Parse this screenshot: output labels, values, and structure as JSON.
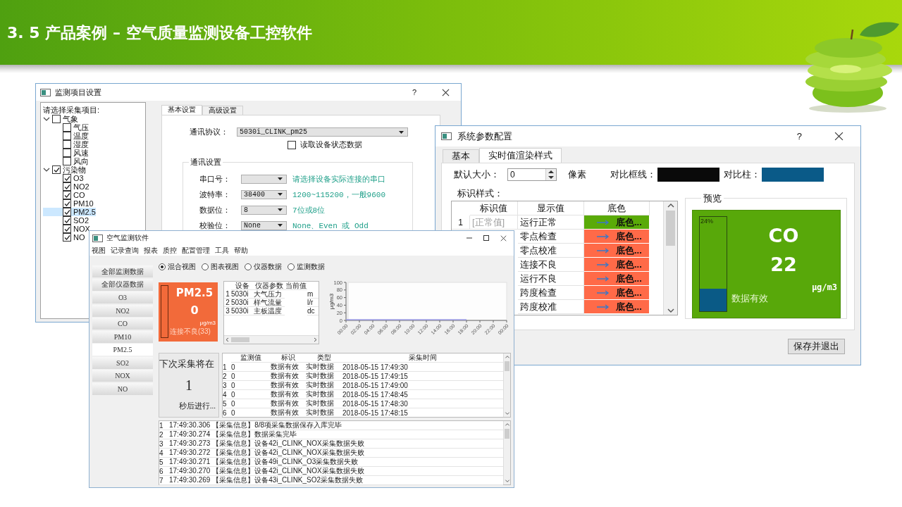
{
  "slide": {
    "title": "3. 5 产品案例 – 空气质量监测设备工控软件"
  },
  "item_settings_window": {
    "title": "监测项目设置",
    "help": "?",
    "tree_label": "请选择采集项目:",
    "tree": [
      {
        "label": "气象",
        "checked": false,
        "expanded": true,
        "selected": false,
        "children": [
          {
            "label": "气压",
            "checked": false,
            "selected": false
          },
          {
            "label": "温度",
            "checked": false,
            "selected": false
          },
          {
            "label": "湿度",
            "checked": false,
            "selected": false
          },
          {
            "label": "风速",
            "checked": false,
            "selected": false
          },
          {
            "label": "风向",
            "checked": false,
            "selected": false
          }
        ]
      },
      {
        "label": "污染物",
        "checked": true,
        "expanded": true,
        "selected": false,
        "children": [
          {
            "label": "O3",
            "checked": true,
            "selected": false
          },
          {
            "label": "NO2",
            "checked": true,
            "selected": false
          },
          {
            "label": "CO",
            "checked": true,
            "selected": false
          },
          {
            "label": "PM10",
            "checked": true,
            "selected": false
          },
          {
            "label": "PM2.5",
            "checked": true,
            "selected": true
          },
          {
            "label": "SO2",
            "checked": true,
            "selected": false
          },
          {
            "label": "NOX",
            "checked": true,
            "selected": false
          },
          {
            "label": "NO",
            "checked": true,
            "selected": false
          }
        ]
      }
    ],
    "tabs": [
      {
        "label": "基本设置",
        "selected": true
      },
      {
        "label": "高级设置",
        "selected": false
      }
    ],
    "protocol": {
      "label": "通讯协议：",
      "value": "5030i_CLINK_pm25"
    },
    "read_status": {
      "label": "读取设备状态数据",
      "checked": false
    },
    "comm_group": {
      "title": "通讯设置",
      "rows": [
        {
          "label": "串口号：",
          "hint": "请选择设备实际连接的串口"
        },
        {
          "label": "波特率：",
          "value": "38400",
          "hint": "1200~115200，一般9600"
        },
        {
          "label": "数据位：",
          "value": "8",
          "hint": "7位或8位"
        },
        {
          "label": "校验位：",
          "value": "None",
          "hint": "None、Even 或 Odd"
        }
      ]
    }
  },
  "config_window": {
    "title": "系统参数配置",
    "help": "?",
    "tabs": [
      {
        "label": "基本",
        "selected": false
      },
      {
        "label": "实时值渲染样式",
        "selected": true
      }
    ],
    "default_size": {
      "label": "默认大小：",
      "value": "0",
      "unit": "像素"
    },
    "contrast_swatches": [
      {
        "label": "对比框线：",
        "color": "#0a0a0a"
      },
      {
        "label": "对比柱：",
        "color": "#0a5a88"
      }
    ],
    "style_table": {
      "label": "标识样式：",
      "columns": [
        "标识值",
        "显示值",
        "底色"
      ],
      "rows": [
        {
          "index": "1",
          "mark": "[正常值]",
          "display": "运行正常",
          "color_text": "底色...",
          "color": "#5aaa08"
        },
        {
          "display": "零点检查",
          "color_text": "底色...",
          "color": "#ff6a48"
        },
        {
          "display": "零点校准",
          "color_text": "底色...",
          "color": "#ff6a48"
        },
        {
          "display": "连接不良",
          "color_text": "底色...",
          "color": "#ff6a48"
        },
        {
          "display": "运行不良",
          "color_text": "底色...",
          "color": "#ff6a48"
        },
        {
          "display": "跨度检查",
          "color_text": "底色...",
          "color": "#ff6a48"
        },
        {
          "display": "跨度校准",
          "color_text": "底色...",
          "color": "#ff6a48"
        }
      ]
    },
    "preview": {
      "title": "预览",
      "level": 0.24,
      "reading": "24%",
      "name": "CO",
      "value": "22",
      "unit": "μg/m3",
      "status": "数据有效"
    },
    "save_button": "保存并退出"
  },
  "app_window": {
    "title": "空气监测软件",
    "menu": [
      "视图",
      "记录查询",
      "报表",
      "质控",
      "配置管理",
      "工具",
      "帮助"
    ],
    "side_buttons": [
      {
        "label": "全部监测数据",
        "selected": false
      },
      {
        "label": "全部仪器数据",
        "selected": false
      },
      {
        "label": "O3",
        "selected": false
      },
      {
        "label": "NO2",
        "selected": false
      },
      {
        "label": "CO",
        "selected": false
      },
      {
        "label": "PM10",
        "selected": false
      },
      {
        "label": "PM2.5",
        "selected": true
      },
      {
        "label": "SO2",
        "selected": false
      },
      {
        "label": "NOX",
        "selected": false
      },
      {
        "label": "NO",
        "selected": false
      }
    ],
    "view_modes": [
      {
        "label": "混合视图",
        "selected": true
      },
      {
        "label": "图表视图",
        "selected": false
      },
      {
        "label": "仪器数据",
        "selected": false
      },
      {
        "label": "监测数据",
        "selected": false
      }
    ],
    "tile": {
      "name": "PM2.5",
      "value": "0",
      "unit": "μg/m3",
      "status": "连接不良(33)"
    },
    "instrument_table": {
      "columns": [
        "设备",
        "仪器参数",
        "当前值"
      ],
      "rows": [
        {
          "index": "1",
          "device": "5030i",
          "parameter": "大气压力",
          "column_5": "m"
        },
        {
          "index": "2",
          "device": "5030i",
          "parameter": "样气流量",
          "column_5": "l/r"
        },
        {
          "index": "3",
          "device": "5030i",
          "parameter": "主板温度",
          "column_5": "dc"
        }
      ]
    },
    "chart_data": {
      "type": "line",
      "ylabel": "μg/m3",
      "categories": [
        "00:00",
        "02:00",
        "04:00",
        "06:00",
        "08:00",
        "10:00",
        "12:00",
        "14:00",
        "16:00",
        "18:00",
        "20:00",
        "22:00",
        "00:00"
      ],
      "series": [
        {
          "color": "#9a9ae6",
          "values": [
            0,
            0,
            0,
            0,
            0,
            0,
            0,
            0,
            0,
            0,
            null,
            null,
            null
          ]
        }
      ],
      "ylim": [
        0,
        100
      ],
      "yticks": [
        0,
        20,
        40,
        60,
        80,
        100
      ]
    },
    "countdown": {
      "prefix": "下次采集将在",
      "value": "1",
      "suffix": "秒后进行..."
    },
    "data_table": {
      "columns": [
        "监测值",
        "标识",
        "类型",
        "采集时间"
      ],
      "rows": [
        {
          "index": "1",
          "value": "0",
          "flag": "数据有效",
          "type": "实时数据",
          "time": "2018-05-15 17:49:30"
        },
        {
          "index": "2",
          "value": "0",
          "flag": "数据有效",
          "type": "实时数据",
          "time": "2018-05-15 17:49:15"
        },
        {
          "index": "3",
          "value": "0",
          "flag": "数据有效",
          "type": "实时数据",
          "time": "2018-05-15 17:49:00"
        },
        {
          "index": "4",
          "value": "0",
          "flag": "数据有效",
          "type": "实时数据",
          "time": "2018-05-15 17:48:45"
        },
        {
          "index": "5",
          "value": "0",
          "flag": "数据有效",
          "type": "实时数据",
          "time": "2018-05-15 17:48:30"
        },
        {
          "index": "6",
          "value": "0",
          "flag": "数据有效",
          "type": "实时数据",
          "time": "2018-05-15 17:48:15"
        }
      ]
    },
    "log": [
      {
        "index": "1",
        "text": "17:49:30.306 【采集信息】8/8项采集数据保存入库完毕"
      },
      {
        "index": "2",
        "text": "17:49:30.274 【采集信息】数据采集完毕"
      },
      {
        "index": "3",
        "text": "17:49:30.273 【采集信息】设备42i_CLINK_NOX采集数据失败"
      },
      {
        "index": "4",
        "text": "17:49:30.272 【采集信息】设备42i_CLINK_NOX采集数据失败"
      },
      {
        "index": "5",
        "text": "17:49:30.271 【采集信息】设备49i_CLINK_O3采集数据失败"
      },
      {
        "index": "6",
        "text": "17:49:30.270 【采集信息】设备42i_CLINK_NOX采集数据失败"
      },
      {
        "index": "7",
        "text": "17:49:30.269 【采集信息】设备43i_CLINK_SO2采集数据失败"
      }
    ]
  }
}
